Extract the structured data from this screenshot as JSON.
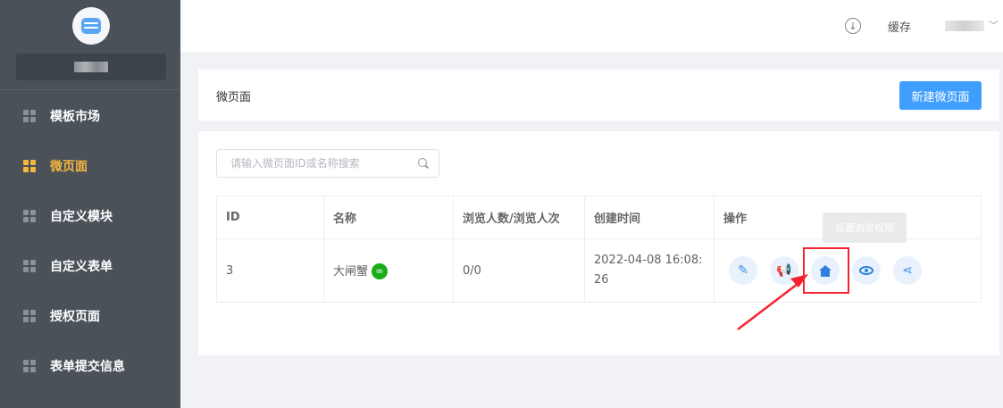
{
  "header": {
    "cache_label": "缓存"
  },
  "sidebar": {
    "items": [
      {
        "label": "模板市场",
        "active": false
      },
      {
        "label": "微页面",
        "active": true
      },
      {
        "label": "自定义模块",
        "active": false
      },
      {
        "label": "自定义表单",
        "active": false
      },
      {
        "label": "授权页面",
        "active": false
      },
      {
        "label": "表单提交信息",
        "active": false
      }
    ]
  },
  "page": {
    "title": "微页面",
    "new_button": "新建微页面"
  },
  "search": {
    "placeholder": "请输入微页面ID或名称搜索"
  },
  "table": {
    "headers": [
      "ID",
      "名称",
      "浏览人数/浏览人次",
      "创建时间",
      "操作"
    ],
    "rows": [
      {
        "id": "3",
        "name": "大闸蟹",
        "views": "0/0",
        "created_line1": "2022-04-08 16:08:",
        "created_line2": "26"
      }
    ]
  },
  "tooltip": "设置浏览权限",
  "icons": [
    "download-icon",
    "chevron-down-icon",
    "grid-icon",
    "search-icon",
    "wechat-miniprogram-icon",
    "pencil-icon",
    "megaphone-icon",
    "house-icon",
    "eye-icon",
    "share-icon"
  ],
  "colors": {
    "sidebar_bg": "#4a5159",
    "active": "#f6b73c",
    "primary": "#409eff",
    "highlight": "#f5232f"
  }
}
